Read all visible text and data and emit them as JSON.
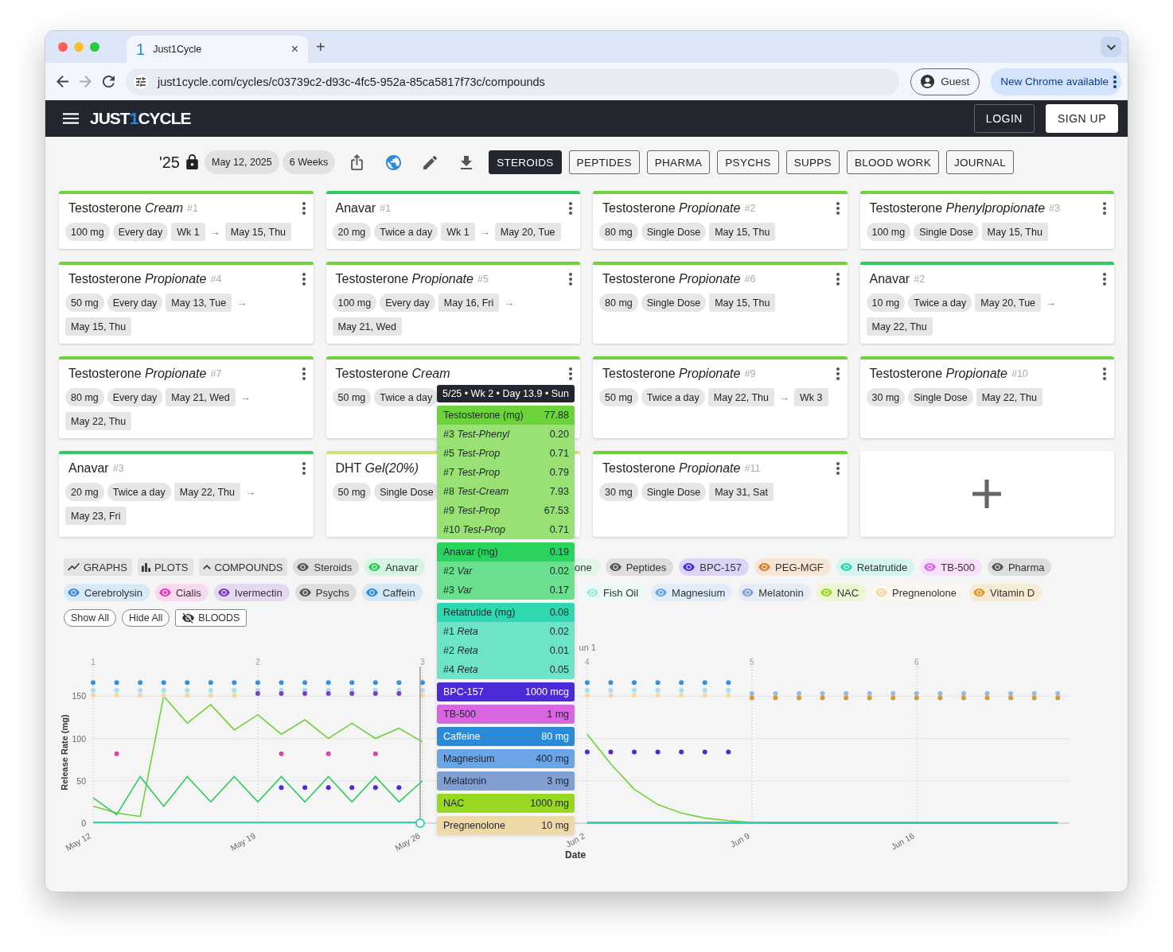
{
  "browser": {
    "tab_icon": "1",
    "tab_title": "Just1Cycle",
    "close": "×",
    "new_tab": "+",
    "url": "just1cycle.com/cycles/c03739c2-d93c-4fc5-952a-85ca5817f73c/compounds",
    "guest": "Guest",
    "update": "New Chrome available"
  },
  "header": {
    "logo": [
      "JUST",
      "1",
      "CYCLE"
    ],
    "login": "LOGIN",
    "signup": "SIGN UP"
  },
  "toolbar": {
    "year": "'25",
    "locked": true,
    "start_date": "May 12, 2025",
    "duration": "6 Weeks",
    "tabs": [
      {
        "label": "STEROIDS",
        "selected": true
      },
      {
        "label": "PEPTIDES",
        "selected": false
      },
      {
        "label": "PHARMA",
        "selected": false
      },
      {
        "label": "PSYCHS",
        "selected": false
      },
      {
        "label": "SUPPS",
        "selected": false
      },
      {
        "label": "BLOOD WORK",
        "selected": false
      },
      {
        "label": "JOURNAL",
        "selected": false
      }
    ]
  },
  "cards": [
    {
      "title": "Testosterone *Cream*",
      "number": "#1",
      "color": "#6fd23a",
      "tags": [
        {
          "kind": "dose",
          "text": "100 mg"
        },
        {
          "kind": "frequency",
          "text": "Every day"
        },
        {
          "kind": "week",
          "text": "Wk 1"
        },
        {
          "kind": "arrow",
          "text": "→"
        },
        {
          "kind": "date",
          "text": "May 15, Thu"
        }
      ]
    },
    {
      "title": "Anavar",
      "number": "#1",
      "color": "#2ecc5e",
      "tags": [
        {
          "kind": "dose",
          "text": "20 mg"
        },
        {
          "kind": "frequency",
          "text": "Twice a day"
        },
        {
          "kind": "week",
          "text": "Wk 1"
        },
        {
          "kind": "arrow",
          "text": "→"
        },
        {
          "kind": "date",
          "text": "May 20, Tue"
        }
      ]
    },
    {
      "title": "Testosterone *Propionate*",
      "number": "#2",
      "color": "#6fd23a",
      "tags": [
        {
          "kind": "dose",
          "text": "80 mg"
        },
        {
          "kind": "frequency",
          "text": "Single Dose"
        },
        {
          "kind": "date",
          "text": "May 15, Thu"
        }
      ]
    },
    {
      "title": "Testosterone *Phenylpropionate*",
      "number": "#3",
      "color": "#6fd23a",
      "tags": [
        {
          "kind": "dose",
          "text": "100 mg"
        },
        {
          "kind": "frequency",
          "text": "Single Dose"
        },
        {
          "kind": "date",
          "text": "May 15, Thu"
        }
      ]
    },
    {
      "title": "Testosterone *Propionate*",
      "number": "#4",
      "color": "#6fd23a",
      "tags": [
        {
          "kind": "dose",
          "text": "50 mg"
        },
        {
          "kind": "frequency",
          "text": "Every day"
        },
        {
          "kind": "date",
          "text": "May 13, Tue"
        },
        {
          "kind": "arrow",
          "text": "→"
        },
        {
          "kind": "date",
          "text": "May 15, Thu"
        }
      ]
    },
    {
      "title": "Testosterone *Propionate*",
      "number": "#5",
      "color": "#6fd23a",
      "tags": [
        {
          "kind": "dose",
          "text": "100 mg"
        },
        {
          "kind": "frequency",
          "text": "Every day"
        },
        {
          "kind": "date",
          "text": "May 16, Fri"
        },
        {
          "kind": "arrow",
          "text": "→"
        },
        {
          "kind": "date",
          "text": "May 21, Wed"
        }
      ]
    },
    {
      "title": "Testosterone *Propionate*",
      "number": "#6",
      "color": "#6fd23a",
      "tags": [
        {
          "kind": "dose",
          "text": "80 mg"
        },
        {
          "kind": "frequency",
          "text": "Single Dose"
        },
        {
          "kind": "date",
          "text": "May 15, Thu"
        }
      ]
    },
    {
      "title": "Anavar",
      "number": "#2",
      "color": "#2ecc5e",
      "tags": [
        {
          "kind": "dose",
          "text": "10 mg"
        },
        {
          "kind": "frequency",
          "text": "Twice a day"
        },
        {
          "kind": "date",
          "text": "May 20, Tue"
        },
        {
          "kind": "arrow",
          "text": "→"
        },
        {
          "kind": "date",
          "text": "May 22, Thu"
        }
      ]
    },
    {
      "title": "Testosterone *Propionate*",
      "number": "#7",
      "color": "#6fd23a",
      "tags": [
        {
          "kind": "dose",
          "text": "80 mg"
        },
        {
          "kind": "frequency",
          "text": "Every day"
        },
        {
          "kind": "date",
          "text": "May 21, Wed"
        },
        {
          "kind": "arrow",
          "text": "→"
        },
        {
          "kind": "date",
          "text": "May 22, Thu"
        }
      ]
    },
    {
      "title": "Testosterone *Cream*",
      "color": "#6fd23a",
      "tags": [
        {
          "kind": "dose",
          "text": "50 mg"
        },
        {
          "kind": "frequency",
          "text": "Twice a day"
        }
      ]
    },
    {
      "title": "Testosterone *Propionate*",
      "number": "#9",
      "color": "#6fd23a",
      "tags": [
        {
          "kind": "dose",
          "text": "50 mg"
        },
        {
          "kind": "frequency",
          "text": "Twice a day"
        },
        {
          "kind": "date",
          "text": "May 22, Thu"
        },
        {
          "kind": "arrow",
          "text": "→"
        },
        {
          "kind": "week",
          "text": "Wk 3"
        }
      ]
    },
    {
      "title": "Testosterone *Propionate*",
      "number": "#10",
      "color": "#6fd23a",
      "tags": [
        {
          "kind": "dose",
          "text": "30 mg"
        },
        {
          "kind": "frequency",
          "text": "Single Dose"
        },
        {
          "kind": "date",
          "text": "May 22, Thu"
        }
      ]
    },
    {
      "title": "Anavar",
      "number": "#3",
      "color": "#2ecc5e",
      "tags": [
        {
          "kind": "dose",
          "text": "20 mg"
        },
        {
          "kind": "frequency",
          "text": "Twice a day"
        },
        {
          "kind": "date",
          "text": "May 22, Thu"
        },
        {
          "kind": "arrow",
          "text": "→"
        },
        {
          "kind": "date",
          "text": "May 23, Fri"
        }
      ]
    },
    {
      "title": "DHT *Gel(20%)*",
      "color": "#d4e07a",
      "tags": [
        {
          "kind": "dose",
          "text": "50 mg"
        },
        {
          "kind": "frequency",
          "text": "Single Dose"
        }
      ]
    },
    {
      "title": "Testosterone *Propionate*",
      "number": "#11",
      "color": "#6fd23a",
      "tags": [
        {
          "kind": "dose",
          "text": "30 mg"
        },
        {
          "kind": "frequency",
          "text": "Single Dose"
        },
        {
          "kind": "date",
          "text": "May 31, Sat"
        }
      ]
    }
  ],
  "legend": {
    "toggles": [
      {
        "kind": "graphs",
        "label": "GRAPHS"
      },
      {
        "kind": "plots",
        "label": "PLOTS"
      },
      {
        "kind": "collapse",
        "label": "COMPOUNDS"
      }
    ],
    "rows": [
      {
        "left": [
          {
            "label": "Steroids",
            "color": "#555555"
          },
          {
            "label": "Anavar",
            "color": "#2ecc5e"
          }
        ],
        "fragment": "one",
        "right": [
          {
            "label": "Peptides",
            "color": "#555555"
          },
          {
            "label": "BPC-157",
            "color": "#4b2bd6"
          },
          {
            "label": "PEG-MGF",
            "color": "#d9822b"
          },
          {
            "label": "Retatrutide",
            "color": "#2fd3b0"
          },
          {
            "label": "TB-500",
            "color": "#d766e0"
          },
          {
            "label": "Pharma",
            "color": "#555555"
          }
        ]
      },
      {
        "left": [
          {
            "label": "Cerebrolysin",
            "color": "#3a8fd8"
          },
          {
            "label": "Cialis",
            "color": "#e040b0"
          },
          {
            "label": "Ivermectin",
            "color": "#7b3fc0"
          },
          {
            "label": "Psychs",
            "color": "#555555"
          },
          {
            "label": "Caffein",
            "color": "#2a8ad8"
          }
        ],
        "right": [
          {
            "label": "Fish Oil",
            "color": "#a0e8d8"
          },
          {
            "label": "Magnesium",
            "color": "#6aa6e6"
          },
          {
            "label": "Melatonin",
            "color": "#7fa0d0"
          },
          {
            "label": "NAC",
            "color": "#99d820"
          },
          {
            "label": "Pregnenolone",
            "color": "#f0d9a8"
          },
          {
            "label": "Vitamin D",
            "color": "#d99a2b"
          }
        ]
      }
    ],
    "buttons": [
      {
        "kind": "plain",
        "label": "Show All"
      },
      {
        "kind": "plain",
        "label": "Hide All"
      },
      {
        "kind": "bloods",
        "label": "BLOODS"
      }
    ]
  },
  "chart": {
    "week_labels": [
      "1",
      "2",
      "3",
      "4",
      "5",
      "6"
    ],
    "hover_note": "un 1",
    "chart_data": {
      "type": "line",
      "xlabel": "Date",
      "ylabel": "Release Rate (mg)",
      "grid": true,
      "categories": [
        "May 12",
        null,
        null,
        null,
        null,
        null,
        null,
        "May 19",
        null,
        null,
        null,
        null,
        null,
        null,
        "May 26",
        null,
        null,
        null,
        null,
        null,
        null,
        "Jun 2",
        null,
        null,
        null,
        null,
        null,
        null,
        "Jun 9",
        null,
        null,
        null,
        null,
        null,
        null,
        "Jun 16",
        null,
        null,
        null,
        null,
        null,
        null
      ],
      "series": [
        {
          "type": "line",
          "color": "#6fd23a",
          "values": [
            20,
            12,
            8,
            150,
            118,
            140,
            110,
            128,
            105,
            122,
            100,
            118,
            100,
            112,
            96,
            null,
            null,
            null,
            null,
            null,
            null,
            105,
            70,
            40,
            22,
            12,
            6,
            3,
            1,
            0,
            0,
            0,
            0,
            0,
            0,
            0,
            0,
            0,
            0,
            0,
            0,
            0
          ]
        },
        {
          "type": "line",
          "color": "#2ecc5e",
          "values": [
            30,
            10,
            55,
            20,
            55,
            25,
            55,
            25,
            55,
            25,
            55,
            25,
            55,
            25,
            50,
            null,
            null,
            null,
            null,
            null,
            null,
            0,
            0,
            0,
            0,
            0,
            0,
            0,
            0,
            0,
            0,
            0,
            0,
            0,
            0,
            0,
            0,
            0,
            0,
            0,
            0,
            0
          ]
        },
        {
          "type": "line",
          "color": "#2fd3b0",
          "values": [
            1,
            1,
            1,
            1,
            1,
            1,
            1,
            1,
            1,
            1,
            1,
            1,
            1,
            1,
            1,
            null,
            null,
            null,
            null,
            null,
            null,
            1,
            1,
            1,
            1,
            1,
            1,
            1,
            1,
            1,
            1,
            1,
            1,
            1,
            1,
            1,
            1,
            1,
            1,
            1,
            1,
            1
          ]
        },
        {
          "type": "scatter",
          "color": "#3a8fd8",
          "values": [
            166,
            166,
            166,
            166,
            166,
            166,
            166,
            166,
            166,
            166,
            166,
            166,
            166,
            166,
            166,
            null,
            null,
            null,
            null,
            null,
            null,
            166,
            166,
            166,
            166,
            166,
            166,
            166,
            null,
            null,
            null,
            null,
            null,
            null,
            null,
            null,
            null,
            null,
            null,
            null,
            null,
            null
          ]
        },
        {
          "type": "scatter",
          "color": "#a8dff0",
          "values": [
            157,
            157,
            157,
            157,
            157,
            157,
            157,
            157,
            157,
            157,
            157,
            157,
            157,
            157,
            157,
            null,
            null,
            null,
            null,
            null,
            null,
            157,
            157,
            157,
            157,
            157,
            157,
            157,
            null,
            null,
            null,
            null,
            null,
            null,
            null,
            null,
            null,
            null,
            null,
            null,
            null,
            null
          ]
        },
        {
          "type": "scatter",
          "color": "#f0d9a8",
          "values": [
            151,
            151,
            151,
            151,
            151,
            151,
            151,
            null,
            null,
            null,
            null,
            null,
            null,
            null,
            151,
            null,
            null,
            null,
            null,
            null,
            null,
            151,
            151,
            151,
            151,
            151,
            151,
            151,
            null,
            null,
            null,
            null,
            null,
            null,
            null,
            null,
            null,
            null,
            null,
            null,
            null,
            null
          ]
        },
        {
          "type": "scatter",
          "color": "#9ab8e0",
          "values": [
            null,
            null,
            null,
            null,
            null,
            null,
            null,
            null,
            null,
            null,
            null,
            null,
            null,
            null,
            null,
            null,
            null,
            null,
            null,
            null,
            null,
            null,
            null,
            null,
            null,
            null,
            null,
            null,
            153,
            153,
            153,
            153,
            153,
            153,
            153,
            153,
            153,
            153,
            153,
            153,
            153,
            153
          ]
        },
        {
          "type": "scatter",
          "color": "#d99a2b",
          "values": [
            null,
            null,
            null,
            null,
            null,
            null,
            null,
            null,
            null,
            null,
            null,
            null,
            null,
            null,
            null,
            null,
            null,
            null,
            null,
            null,
            null,
            null,
            null,
            null,
            null,
            null,
            null,
            null,
            148,
            148,
            148,
            148,
            148,
            148,
            148,
            148,
            148,
            148,
            148,
            148,
            148,
            148
          ]
        },
        {
          "type": "scatter",
          "color": "#7b3fc0",
          "values": [
            null,
            null,
            null,
            null,
            null,
            null,
            null,
            153,
            153,
            153,
            153,
            153,
            153,
            153,
            null,
            null,
            null,
            null,
            null,
            null,
            null,
            null,
            null,
            null,
            null,
            null,
            null,
            null,
            null,
            null,
            null,
            null,
            null,
            null,
            null,
            null,
            null,
            null,
            null,
            null,
            null,
            null
          ]
        },
        {
          "type": "scatter",
          "color": "#4b2bd6",
          "values": [
            null,
            null,
            null,
            null,
            null,
            null,
            null,
            null,
            null,
            null,
            null,
            null,
            null,
            null,
            null,
            null,
            null,
            null,
            null,
            null,
            null,
            84,
            84,
            84,
            84,
            84,
            84,
            84,
            null,
            null,
            null,
            null,
            null,
            null,
            null,
            null,
            null,
            null,
            null,
            null,
            null,
            null
          ]
        },
        {
          "type": "scatter",
          "color": "#4b2bd6",
          "values": [
            null,
            null,
            null,
            null,
            null,
            null,
            null,
            null,
            42,
            42,
            42,
            42,
            42,
            42,
            null,
            null,
            null,
            null,
            null,
            null,
            null,
            null,
            null,
            null,
            null,
            null,
            null,
            null,
            null,
            null,
            null,
            null,
            null,
            null,
            null,
            null,
            null,
            null,
            null,
            null,
            null,
            null
          ]
        },
        {
          "type": "scatter",
          "color": "#e040b0",
          "values": [
            null,
            82,
            null,
            null,
            null,
            null,
            null,
            null,
            82,
            null,
            82,
            null,
            82,
            null,
            null,
            null,
            null,
            null,
            null,
            null,
            null,
            null,
            null,
            null,
            null,
            null,
            null,
            null,
            null,
            null,
            null,
            null,
            null,
            null,
            null,
            null,
            null,
            null,
            null,
            null,
            null,
            null
          ]
        }
      ],
      "ylim": [
        0,
        185
      ],
      "yticks": [
        0,
        50,
        100,
        150
      ]
    }
  },
  "tooltip": {
    "title": "5/25 • Wk 2 • Day 13.9 • Sun",
    "groups": [
      {
        "label": "Testosterone (mg)",
        "value": "77.88",
        "color": "#6dd33a",
        "rows": [
          {
            "label": "#3 *Test-Phenyl*",
            "value": "0.20"
          },
          {
            "label": "#5 *Test-Prop*",
            "value": "0.71"
          },
          {
            "label": "#7 *Test-Prop*",
            "value": "0.79"
          },
          {
            "label": "#8 *Test-Cream*",
            "value": "7.93"
          },
          {
            "label": "#9 *Test-Prop*",
            "value": "67.53"
          },
          {
            "label": "#10 *Test-Prop*",
            "value": "0.71"
          }
        ]
      },
      {
        "label": "Anavar (mg)",
        "value": "0.19",
        "color": "#2ad35e",
        "rows": [
          {
            "label": "#2 *Var*",
            "value": "0.02"
          },
          {
            "label": "#3 *Var*",
            "value": "0.17"
          }
        ]
      },
      {
        "label": "Retatrutide (mg)",
        "value": "0.08",
        "color": "#2fd8b0",
        "rows": [
          {
            "label": "#1 *Reta*",
            "value": "0.02"
          },
          {
            "label": "#2 *Reta*",
            "value": "0.01"
          },
          {
            "label": "#4 *Reta*",
            "value": "0.05"
          }
        ]
      }
    ],
    "items": [
      {
        "label": "BPC-157",
        "value": "1000 mcg",
        "color": "#4b2bd6"
      },
      {
        "label": "TB-500",
        "value": "1 mg",
        "color": "#d766e0"
      },
      {
        "label": "Caffeine",
        "value": "80 mg",
        "color": "#2a8ad8"
      },
      {
        "label": "Magnesium",
        "value": "400 mg",
        "color": "#6aa6e6"
      },
      {
        "label": "Melatonin",
        "value": "3 mg",
        "color": "#7fa0d0"
      },
      {
        "label": "NAC",
        "value": "1000 mg",
        "color": "#99d820"
      },
      {
        "label": "Pregnenolone",
        "value": "10 mg",
        "color": "#f0d9a8"
      }
    ]
  }
}
